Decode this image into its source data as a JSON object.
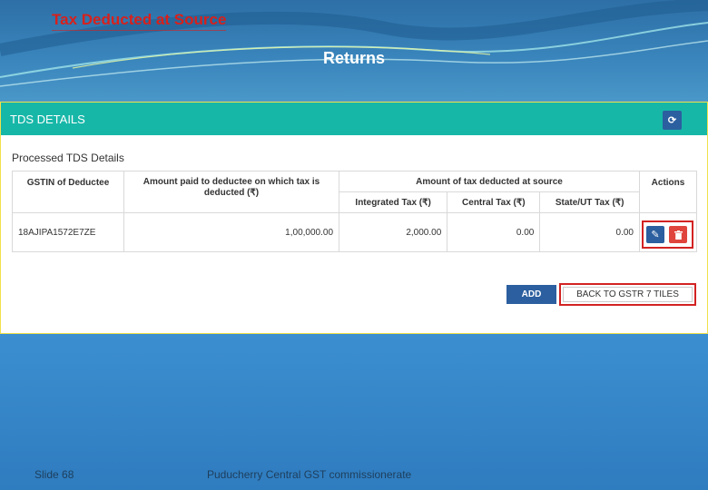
{
  "slide": {
    "title": "Tax Deducted at Source",
    "heading": "Returns",
    "footer_slide": "Slide 68",
    "footer_org": "Puducherry Central GST commissionerate"
  },
  "panel": {
    "title": "TDS DETAILS",
    "refresh_icon": "refresh-icon",
    "subtitle": "Processed TDS Details"
  },
  "table": {
    "headers": {
      "gstin": "GSTIN of Deductee",
      "amount_paid": "Amount paid to deductee on which tax is deducted (₹)",
      "tax_group": "Amount of tax deducted at source",
      "integrated": "Integrated Tax (₹)",
      "central": "Central Tax (₹)",
      "state": "State/UT Tax (₹)",
      "actions": "Actions"
    },
    "rows": [
      {
        "gstin": "18AJIPA1572E7ZE",
        "amount_paid": "1,00,000.00",
        "integrated": "2,000.00",
        "central": "0.00",
        "state": "0.00"
      }
    ]
  },
  "buttons": {
    "edit_icon": "pencil-icon",
    "delete_icon": "trash-icon",
    "add": "ADD",
    "back": "BACK TO GSTR 7 TILES"
  },
  "colors": {
    "header_teal": "#17b7a8",
    "primary_blue": "#2b5f9f",
    "danger_red": "#e0453d",
    "highlight_red": "#d32222",
    "title_red": "#d8201b"
  }
}
